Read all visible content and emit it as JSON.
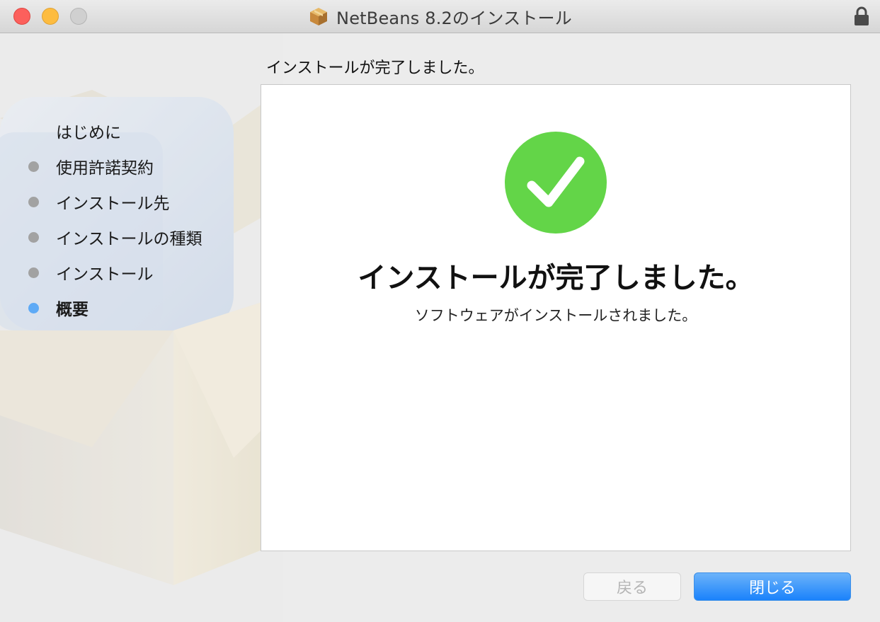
{
  "window": {
    "title": "NetBeans 8.2のインストール",
    "traffic_colors": {
      "close": "#fc605c",
      "minimize": "#fdbc40",
      "zoom": "#d0d0d0"
    }
  },
  "sidebar": {
    "steps": [
      {
        "label": "はじめに",
        "state": "done"
      },
      {
        "label": "使用許諾契約",
        "state": "done"
      },
      {
        "label": "インストール先",
        "state": "done"
      },
      {
        "label": "インストールの種類",
        "state": "done"
      },
      {
        "label": "インストール",
        "state": "done"
      },
      {
        "label": "概要",
        "state": "current"
      }
    ],
    "current_color": "#5eaaf6"
  },
  "main": {
    "heading": "インストールが完了しました。",
    "result_title": "インストールが完了しました。",
    "result_message": "ソフトウェアがインストールされました。",
    "status_icon": "checkmark-success-icon",
    "success_color": "#63d548"
  },
  "buttons": {
    "back_label": "戻る",
    "close_label": "閉じる",
    "accent": "#1a82fb"
  }
}
